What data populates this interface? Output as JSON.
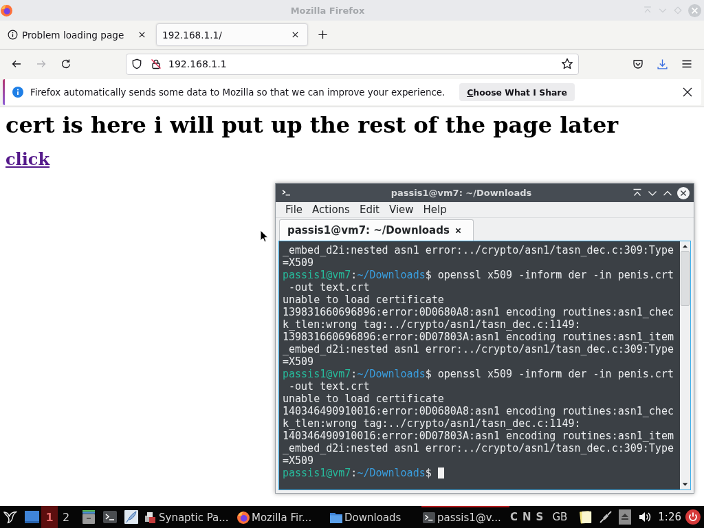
{
  "firefox": {
    "window": {
      "title": "Mozilla Firefox",
      "focused": false
    },
    "tabs": [
      {
        "label": "Problem loading page",
        "kind": "error",
        "selected": false
      },
      {
        "label": "192.168.1.1/",
        "kind": "page",
        "selected": true
      }
    ],
    "nav_buttons": [
      {
        "kind": "back",
        "disabled": false
      },
      {
        "kind": "forward",
        "disabled": true
      },
      {
        "kind": "reload",
        "disabled": false
      }
    ],
    "address_bar": {
      "value": "192.168.1.1",
      "secure": false
    },
    "notification": {
      "text": "Firefox automatically sends some data to Mozilla so that we can improve your experience.",
      "button": "Choose What I Share"
    },
    "page": {
      "heading": "cert is here i will put up the rest of the page later",
      "link": {
        "text": "click",
        "visited": true
      }
    }
  },
  "terminal": {
    "window": {
      "title": "passis1@vm7: ~/Downloads",
      "focused": true
    },
    "menu": [
      "File",
      "Actions",
      "Edit",
      "View",
      "Help"
    ],
    "tabs": [
      {
        "label": "passis1@vm7: ~/Downloads",
        "selected": true
      }
    ],
    "lines": [
      {
        "kind": "output",
        "text": "_embed_d2i:nested asn1 error:../crypto/asn1/tasn_dec.c:309:Type"
      },
      {
        "kind": "output",
        "text": "=X509"
      },
      {
        "kind": "prompt",
        "user": "passis1@vm7",
        "separator": ":",
        "path": "~/Downloads",
        "symbol": "$",
        "command": "openssl x509 -inform der -in penis.crt",
        "cursor": false
      },
      {
        "kind": "output",
        "text": " -out text.crt"
      },
      {
        "kind": "output",
        "text": "unable to load certificate"
      },
      {
        "kind": "output",
        "text": "139831660696896:error:0D0680A8:asn1 encoding routines:asn1_chec"
      },
      {
        "kind": "output",
        "text": "k_tlen:wrong tag:../crypto/asn1/tasn_dec.c:1149:"
      },
      {
        "kind": "output",
        "text": "139831660696896:error:0D07803A:asn1 encoding routines:asn1_item"
      },
      {
        "kind": "output",
        "text": "_embed_d2i:nested asn1 error:../crypto/asn1/tasn_dec.c:309:Type"
      },
      {
        "kind": "output",
        "text": "=X509"
      },
      {
        "kind": "prompt",
        "user": "passis1@vm7",
        "separator": ":",
        "path": "~/Downloads",
        "symbol": "$",
        "command": "openssl x509 -inform der -in penis.crt",
        "cursor": false
      },
      {
        "kind": "output",
        "text": " -out text.crt"
      },
      {
        "kind": "output",
        "text": "unable to load certificate"
      },
      {
        "kind": "output",
        "text": "140346490910016:error:0D0680A8:asn1 encoding routines:asn1_chec"
      },
      {
        "kind": "output",
        "text": "k_tlen:wrong tag:../crypto/asn1/tasn_dec.c:1149:"
      },
      {
        "kind": "output",
        "text": "140346490910016:error:0D07803A:asn1 encoding routines:asn1_item"
      },
      {
        "kind": "output",
        "text": "_embed_d2i:nested asn1 error:../crypto/asn1/tasn_dec.c:309:Type"
      },
      {
        "kind": "output",
        "text": "=X509"
      },
      {
        "kind": "prompt",
        "user": "passis1@vm7",
        "separator": ":",
        "path": "~/Downloads",
        "symbol": "$",
        "cursor": true
      }
    ]
  },
  "taskbar": {
    "workspaces": [
      {
        "label": "1",
        "selected": true
      },
      {
        "label": "2",
        "selected": false
      }
    ],
    "tasks": [
      {
        "label": "Synaptic Pa...",
        "kind": "package",
        "selected": false
      },
      {
        "label": "Mozilla Fir...",
        "kind": "browser",
        "selected": false
      },
      {
        "label": "Downloads",
        "kind": "folder",
        "selected": false
      },
      {
        "label": "passis1@v...",
        "kind": "terminal",
        "selected": true
      }
    ],
    "indicators": [
      "C",
      "N",
      "S"
    ],
    "keyboard_layout": "GB",
    "clock": "1:26"
  }
}
